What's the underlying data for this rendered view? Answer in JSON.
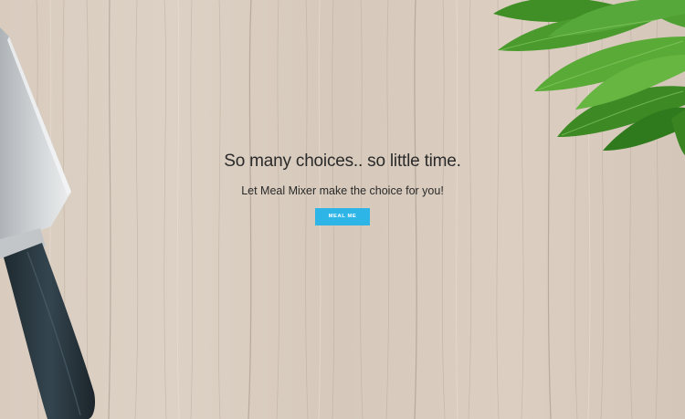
{
  "hero": {
    "headline": "So many choices.. so little time.",
    "subline": "Let Meal Mixer make the choice for you!",
    "button_label": "MEAL ME"
  },
  "colors": {
    "button_bg": "#2eb5e8",
    "button_text": "#ffffff",
    "text": "#2a2a2a",
    "wood": "#d8cbbd",
    "knife_handle": "#2c3a42",
    "knife_blade": "#c9cdd0",
    "leaves": "#4a9a2e"
  },
  "icons": {
    "background": "wood-table-background",
    "left_decoration": "chef-knife-image",
    "right_decoration": "green-leaves-image"
  }
}
